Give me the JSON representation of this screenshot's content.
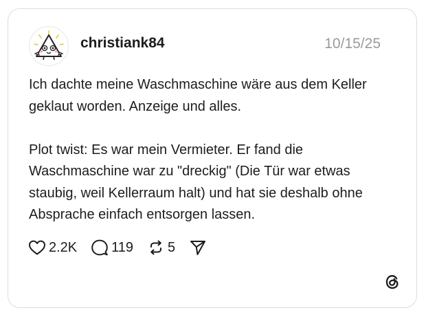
{
  "post": {
    "username": "christiank84",
    "timestamp": "10/15/25",
    "paragraphs": [
      "Ich dachte meine Waschmaschine wäre aus dem Keller geklaut worden. Anzeige und alles.",
      "Plot twist: Es war mein Vermieter. Er fand die Waschmaschine war zu \"dreckig\" (Die Tür war etwas staubig, weil Kellerraum halt) und hat sie deshalb ohne Absprache einfach entsorgen lassen."
    ],
    "actions": {
      "likes": "2.2K",
      "replies": "119",
      "reposts": "5"
    }
  },
  "icons": {
    "like": "heart-icon",
    "reply": "speech-bubble-icon",
    "repost": "repost-arrows-icon",
    "share": "paper-plane-icon",
    "brand": "threads-logo-icon",
    "avatar": "cartoon-triangle-avatar"
  },
  "colors": {
    "text": "#1c1c1c",
    "muted": "#9a9a9a",
    "border": "#dcdcdc"
  }
}
